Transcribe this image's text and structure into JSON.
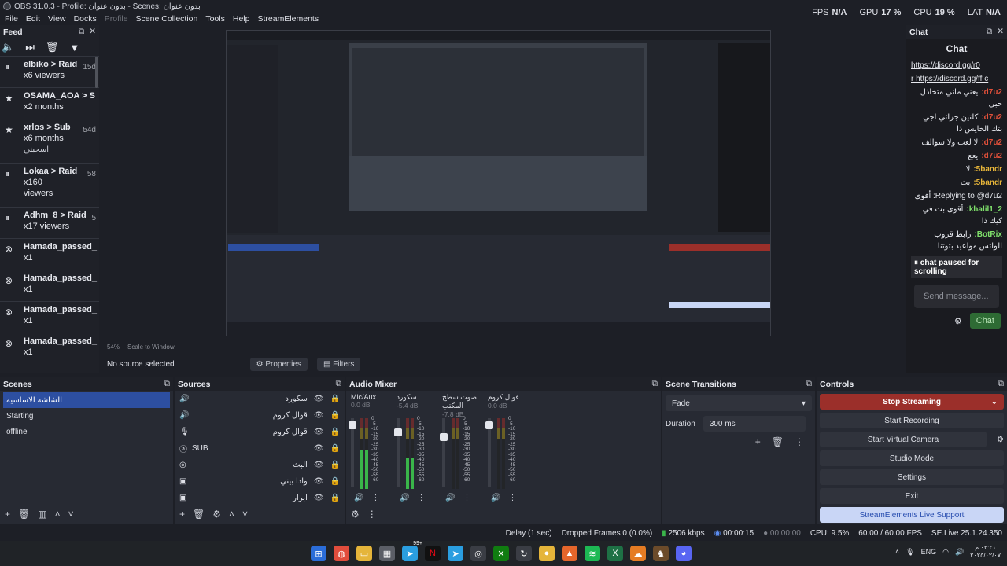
{
  "window": {
    "title": "OBS 31.0.3 - Profile: بدون عنوان - Scenes: بدون عنوان"
  },
  "menu": [
    "File",
    "Edit",
    "View",
    "Docks",
    "Profile",
    "Scene Collection",
    "Tools",
    "Help",
    "StreamElements"
  ],
  "stats": {
    "fps_label": "FPS",
    "fps_value": "N/A",
    "gpu_label": "GPU",
    "gpu_value": "17 %",
    "cpu_label": "CPU",
    "cpu_value": "19 %",
    "lat_label": "LAT",
    "lat_value": "N/A"
  },
  "feed": {
    "title": "Feed",
    "items": [
      {
        "icon": "raid-icon",
        "line1": "elbiko > Raid",
        "line2": "x6 viewers",
        "time": "15d"
      },
      {
        "icon": "sub-icon",
        "line1": "OSAMA_AOA > S",
        "line2": "x2 months",
        "time": ""
      },
      {
        "icon": "star-icon",
        "line1": "xrlos > Sub",
        "line2": "x6 months",
        "extra": "اسحبني",
        "time": "54d"
      },
      {
        "icon": "raid-icon",
        "line1": "Lokaa > Raid",
        "line2": "x160",
        "line3": "viewers",
        "time": "58"
      },
      {
        "icon": "raid-icon",
        "line1": "Adhm_8 > Raid",
        "line2": "x17 viewers",
        "time": "5"
      },
      {
        "icon": "x-icon",
        "line1": "Hamada_passed_",
        "line2": "x1",
        "time": ""
      },
      {
        "icon": "x-icon",
        "line1": "Hamada_passed_",
        "line2": "x1",
        "time": ""
      },
      {
        "icon": "x-icon",
        "line1": "Hamada_passed_",
        "line2": "x1",
        "time": ""
      },
      {
        "icon": "x-icon",
        "line1": "Hamada_passed_",
        "line2": "x1",
        "time": ""
      }
    ]
  },
  "preview": {
    "zoom": "54%",
    "scale_label": "Scale to Window"
  },
  "source_bar": {
    "no_source": "No source selected",
    "properties": "Properties",
    "filters": "Filters"
  },
  "chat": {
    "title": "Chat",
    "header": "Chat",
    "lines": [
      {
        "type": "link",
        "text": "https://discord.gg/r0"
      },
      {
        "type": "link",
        "text": "r  https://discord.gg/ff c"
      },
      {
        "user": "d7u2:",
        "text": "يعني ماني متخاذل حبي"
      },
      {
        "user": "d7u2:",
        "text": "كلتين جزائي اجي بتك الخايس ذا"
      },
      {
        "user": "d7u2:",
        "text": "لا لعب ولا سوالف"
      },
      {
        "user": "d7u2:",
        "text": "يعع"
      },
      {
        "user": "5bandr:",
        "text": "لا"
      },
      {
        "user": "5bandr:",
        "text": "بث"
      },
      {
        "user": "",
        "text": "Replying to @d7u2: أقوى"
      },
      {
        "user": "khalil1_2:",
        "text": "أقوى بث في كيك ذا"
      },
      {
        "user": "BotRix:",
        "text": "رابط قروب الواتس مواعيد بثوتنا"
      }
    ],
    "paused": "chat paused for scrolling",
    "input_placeholder": "Send message...",
    "send_label": "Chat"
  },
  "scenes": {
    "title": "Scenes",
    "items": [
      {
        "name": "الشاشه الاساسيه",
        "selected": true
      },
      {
        "name": "Starting",
        "selected": false
      },
      {
        "name": "offline",
        "selected": false
      }
    ]
  },
  "sources": {
    "title": "Sources",
    "items": [
      {
        "icon": "speaker-icon",
        "name": "سكورد"
      },
      {
        "icon": "speaker-icon",
        "name": "قوال كروم"
      },
      {
        "icon": "mic-icon",
        "name": "قوال كروم"
      },
      {
        "icon": "text-icon",
        "name": "SUB"
      },
      {
        "icon": "browser-icon",
        "name": "البث"
      },
      {
        "icon": "window-icon",
        "name": "وادا بيني"
      },
      {
        "icon": "window-icon",
        "name": "ابرار"
      }
    ]
  },
  "mixer": {
    "title": "Audio Mixer",
    "channels": [
      {
        "name": "Mic/Aux",
        "db": "0.0 dB",
        "level": 0.55,
        "fader": 0.95
      },
      {
        "name": "سكورد",
        "db": "-5.4 dB",
        "level": 0.45,
        "fader": 0.85
      },
      {
        "name": "صوت سطح المكتب",
        "db": "-7.8 dB",
        "level": 0.0,
        "fader": 0.78
      },
      {
        "name": "قوال كروم",
        "db": "0.0 dB",
        "level": 0.0,
        "fader": 0.95
      }
    ],
    "scale": [
      "0",
      "-5",
      "-10",
      "-15",
      "-20",
      "-25",
      "-30",
      "-35",
      "-40",
      "-45",
      "-50",
      "-55",
      "-60"
    ]
  },
  "transitions": {
    "title": "Scene Transitions",
    "selected": "Fade",
    "duration_label": "Duration",
    "duration_value": "300 ms"
  },
  "controls": {
    "title": "Controls",
    "stop_streaming": "Stop Streaming",
    "start_recording": "Start Recording",
    "start_virtual_camera": "Start Virtual Camera",
    "studio_mode": "Studio Mode",
    "settings": "Settings",
    "exit": "Exit",
    "se_support": "StreamElements Live Support"
  },
  "status": {
    "delay": "Delay (1 sec)",
    "dropped": "Dropped Frames 0 (0.0%)",
    "kbps": "2506 kbps",
    "stream_time": "00:00:15",
    "rec_time": "00:00:00",
    "cpu": "CPU: 9.5%",
    "fps": "60.00 / 60.00 FPS",
    "se_version": "SE.Live 25.1.24.350"
  },
  "taskbar": {
    "lang": "ENG",
    "time": "٠٢:٢١ م",
    "date": "٢٠٢٥/٠٢/٠٧",
    "badge": "99+"
  },
  "colors": {
    "accent": "#2d4fa1",
    "stop": "#9b2f2a",
    "se": "#c9d6f6",
    "meter_green": "#3ab54a"
  }
}
